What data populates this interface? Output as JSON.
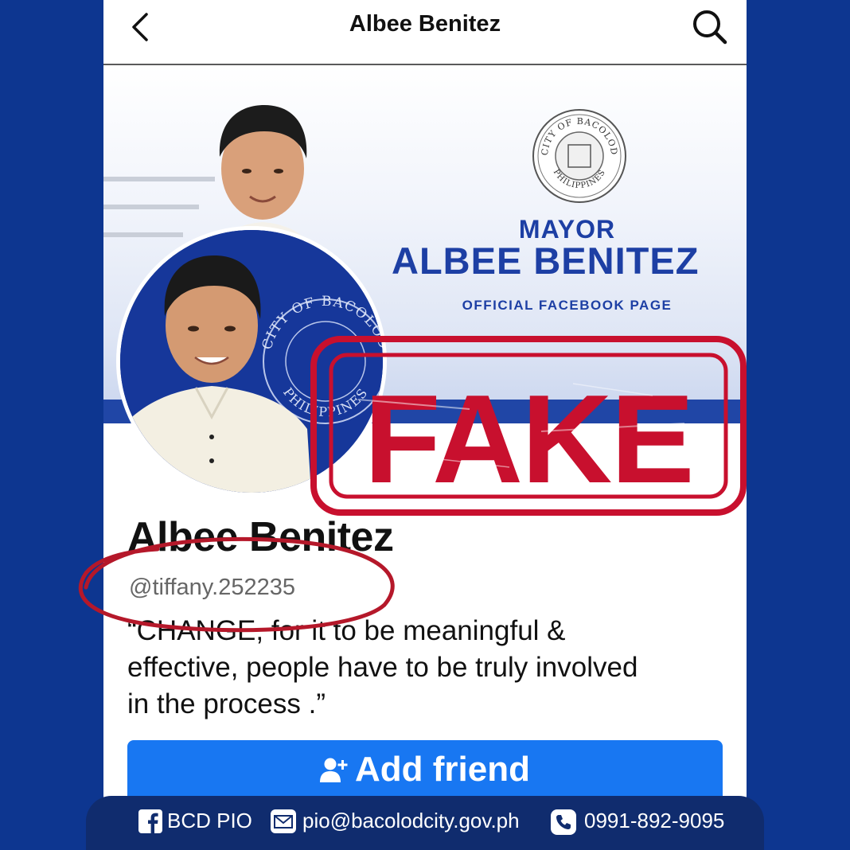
{
  "header": {
    "title": "Albee Benitez",
    "back_icon": "chevron-left-icon",
    "search_icon": "search-icon"
  },
  "cover": {
    "seal_text_top": "CITY OF BACOLOD",
    "seal_text_bottom": "PHILIPPINES",
    "mayor_label": "MAYOR",
    "name_label": "ALBEE BENITEZ",
    "official_label": "OFFICIAL FACEBOOK PAGE"
  },
  "avatar": {
    "seal_text_top": "CITY OF BACOLOD",
    "seal_text_bottom": "PHILIPPINES"
  },
  "profile": {
    "name": "Albee Benitez",
    "username": "@tiffany.252235",
    "bio_lines": [
      "“CHANGE, for it to be meaningful &",
      "effective, people have to be truly involved",
      "in the process .”"
    ]
  },
  "actions": {
    "add_friend_label": "Add friend",
    "add_friend_icon": "add-user-icon"
  },
  "overlay": {
    "stamp_text": "FAKE",
    "stamp_color": "#c8102e"
  },
  "footer": {
    "facebook_label": "BCD PIO",
    "email": "pio@bacolodcity.gov.ph",
    "phone": "0991-892-9095"
  },
  "colors": {
    "background": "#0d3690",
    "accent": "#1877f2",
    "cover_text": "#1d3fa4"
  }
}
